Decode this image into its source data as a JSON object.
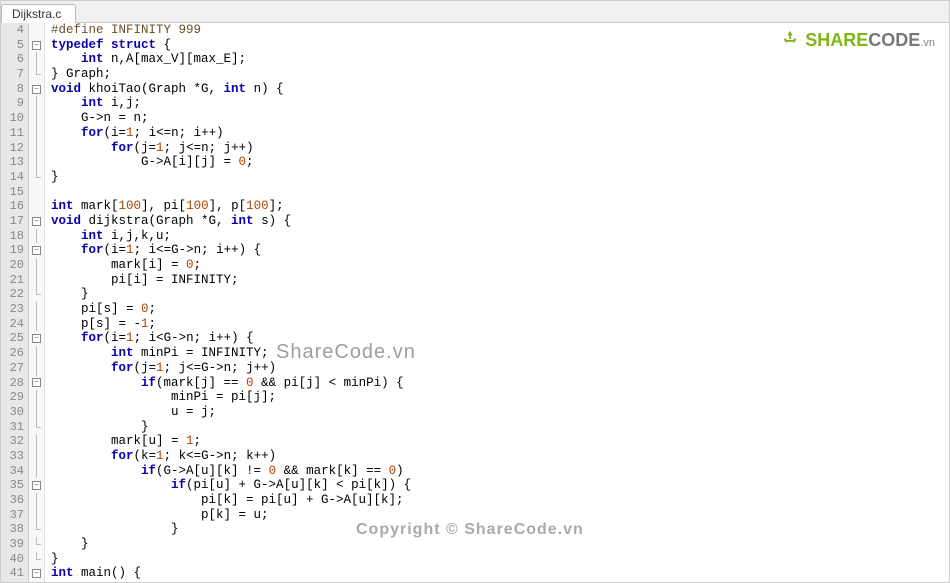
{
  "tab": {
    "name": "Dijkstra.c"
  },
  "logo": {
    "part1": "SHARE",
    "part2": "CODE",
    "suffix": ".vn"
  },
  "watermarks": {
    "wm1": "ShareCode.vn",
    "wm2": "Copyright © ShareCode.vn"
  },
  "startLine": 4,
  "lines": [
    {
      "n": 4,
      "fold": "",
      "html": "<span class='macro'>#define INFINITY 999</span>"
    },
    {
      "n": 5,
      "fold": "box",
      "html": "<span class='kw'>typedef</span> <span class='kw'>struct</span> {"
    },
    {
      "n": 6,
      "fold": "v",
      "html": "    <span class='kw'>int</span> n,A[max_V][max_E];"
    },
    {
      "n": 7,
      "fold": "end",
      "html": "} Graph;"
    },
    {
      "n": 8,
      "fold": "box",
      "html": "<span class='kw'>void</span> khoiTao(Graph *G, <span class='kw'>int</span> n) {"
    },
    {
      "n": 9,
      "fold": "v",
      "html": "    <span class='kw'>int</span> i,j;"
    },
    {
      "n": 10,
      "fold": "v",
      "html": "    G-&gt;n = n;"
    },
    {
      "n": 11,
      "fold": "v",
      "html": "    <span class='kw'>for</span>(i=<span class='num'>1</span>; i&lt;=n; i++)"
    },
    {
      "n": 12,
      "fold": "v",
      "html": "        <span class='kw'>for</span>(j=<span class='num'>1</span>; j&lt;=n; j++)"
    },
    {
      "n": 13,
      "fold": "v",
      "html": "            G-&gt;A[i][j] = <span class='num'>0</span>;"
    },
    {
      "n": 14,
      "fold": "end",
      "html": "}"
    },
    {
      "n": 15,
      "fold": "",
      "html": ""
    },
    {
      "n": 16,
      "fold": "",
      "html": "<span class='kw'>int</span> mark[<span class='num'>100</span>], pi[<span class='num'>100</span>], p[<span class='num'>100</span>];"
    },
    {
      "n": 17,
      "fold": "box",
      "html": "<span class='kw'>void</span> dijkstra(Graph *G, <span class='kw'>int</span> s) {"
    },
    {
      "n": 18,
      "fold": "v",
      "html": "    <span class='kw'>int</span> i,j,k,u;"
    },
    {
      "n": 19,
      "fold": "box",
      "html": "    <span class='kw'>for</span>(i=<span class='num'>1</span>; i&lt;=G-&gt;n; i++) {"
    },
    {
      "n": 20,
      "fold": "v",
      "html": "        mark[i] = <span class='num'>0</span>;"
    },
    {
      "n": 21,
      "fold": "v",
      "html": "        pi[i] = INFINITY;"
    },
    {
      "n": 22,
      "fold": "end",
      "html": "    }"
    },
    {
      "n": 23,
      "fold": "v",
      "html": "    pi[s] = <span class='num'>0</span>;"
    },
    {
      "n": 24,
      "fold": "v",
      "html": "    p[s] = -<span class='num'>1</span>;"
    },
    {
      "n": 25,
      "fold": "box",
      "html": "    <span class='kw'>for</span>(i=<span class='num'>1</span>; i&lt;G-&gt;n; i++) {"
    },
    {
      "n": 26,
      "fold": "v",
      "html": "        <span class='kw'>int</span> minPi = INFINITY;"
    },
    {
      "n": 27,
      "fold": "v",
      "html": "        <span class='kw'>for</span>(j=<span class='num'>1</span>; j&lt;=G-&gt;n; j++)"
    },
    {
      "n": 28,
      "fold": "box",
      "html": "            <span class='kw'>if</span>(mark[j] == <span class='num'>0</span> &amp;&amp; pi[j] &lt; minPi) {"
    },
    {
      "n": 29,
      "fold": "v",
      "html": "                minPi = pi[j];"
    },
    {
      "n": 30,
      "fold": "v",
      "html": "                u = j;"
    },
    {
      "n": 31,
      "fold": "end",
      "html": "            }"
    },
    {
      "n": 32,
      "fold": "v",
      "html": "        mark[u] = <span class='num'>1</span>;"
    },
    {
      "n": 33,
      "fold": "v",
      "html": "        <span class='kw'>for</span>(k=<span class='num'>1</span>; k&lt;=G-&gt;n; k++)"
    },
    {
      "n": 34,
      "fold": "v",
      "html": "            <span class='kw'>if</span>(G-&gt;A[u][k] != <span class='num'>0</span> &amp;&amp; mark[k] == <span class='num'>0</span>)"
    },
    {
      "n": 35,
      "fold": "box",
      "html": "                <span class='kw'>if</span>(pi[u] + G-&gt;A[u][k] &lt; pi[k]) {"
    },
    {
      "n": 36,
      "fold": "v",
      "html": "                    pi[k] = pi[u] + G-&gt;A[u][k];"
    },
    {
      "n": 37,
      "fold": "v",
      "html": "                    p[k] = u;"
    },
    {
      "n": 38,
      "fold": "end",
      "html": "                }"
    },
    {
      "n": 39,
      "fold": "end",
      "html": "    }"
    },
    {
      "n": 40,
      "fold": "end",
      "html": "}"
    },
    {
      "n": 41,
      "fold": "box",
      "html": "<span class='kw'>int</span> main() {"
    }
  ]
}
